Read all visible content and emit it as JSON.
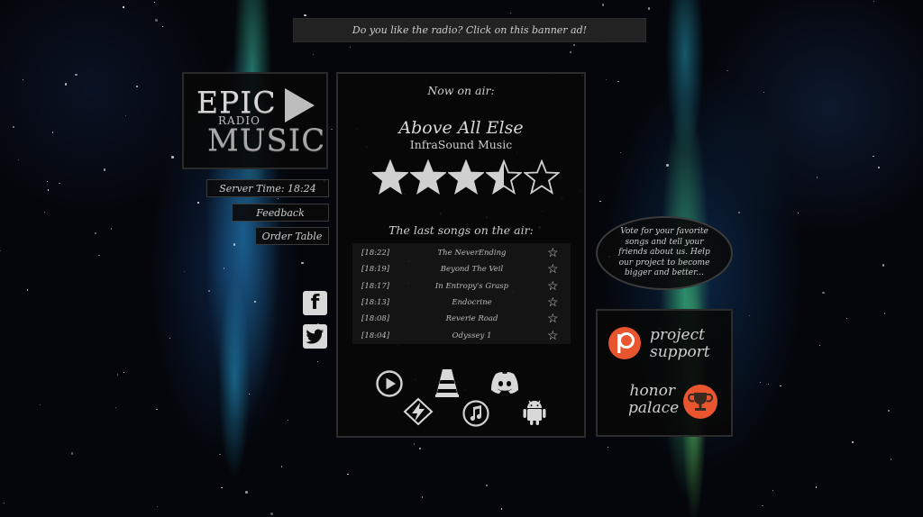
{
  "banner": {
    "text": "Do you like the radio? Click on this banner ad!"
  },
  "logo": {
    "line1": "EPIC",
    "line2": "RADIO",
    "line3": "MUSIC"
  },
  "sidebar": {
    "server_time": "Server Time: 18:24",
    "feedback": "Feedback",
    "order_table": "Order Table"
  },
  "social": {
    "facebook_icon": "f",
    "twitter_icon": "twitter-bird"
  },
  "now_playing": {
    "label": "Now on air:",
    "title": "Above All Else",
    "artist": "InfraSound Music",
    "rating": 3.5,
    "rating_max": 5
  },
  "history": {
    "label": "The last songs on the air:",
    "rows": [
      {
        "time": "[18:22]",
        "title": "The NeverEnding"
      },
      {
        "time": "[18:19]",
        "title": "Beyond The Veil"
      },
      {
        "time": "[18:17]",
        "title": "In Entropy's Grasp"
      },
      {
        "time": "[18:13]",
        "title": "Endocrine"
      },
      {
        "time": "[18:08]",
        "title": "Reverie Road"
      },
      {
        "time": "[18:04]",
        "title": "Odyssey 1"
      }
    ]
  },
  "players": [
    "play-circle-icon",
    "vlc-icon",
    "discord-icon",
    "winamp-icon",
    "itunes-icon",
    "android-icon"
  ],
  "vote": {
    "text": "Vote for your favorite songs and tell your friends about us. Help our project to become bigger and better..."
  },
  "support": {
    "project": "project",
    "support": "support",
    "honor": "honor",
    "palace": "palace"
  },
  "colors": {
    "accent": "#e8552f",
    "panel": "#080808",
    "text": "#cfcfcf"
  }
}
